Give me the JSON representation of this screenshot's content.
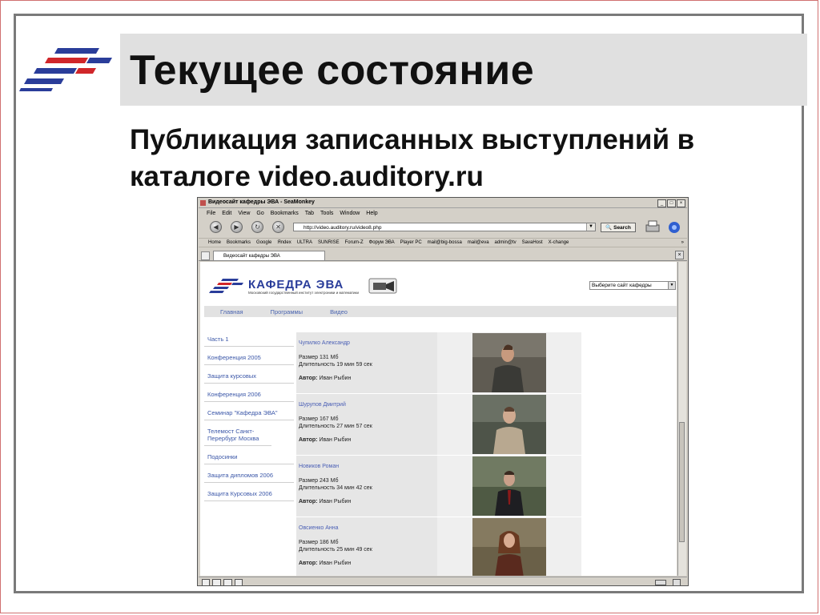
{
  "slide": {
    "title": "Текущее состояние",
    "subtitle": "Публикация записанных выступлений в каталоге video.auditory.ru"
  },
  "browser": {
    "window_title": "Видеосайт кафедры ЭВА - SeaMonkey",
    "menu": [
      "File",
      "Edit",
      "View",
      "Go",
      "Bookmarks",
      "Tab",
      "Tools",
      "Window",
      "Help"
    ],
    "url": "http://video.auditory.ru/video8.php",
    "search_label": "Search",
    "bookmarks": [
      "Home",
      "Bookmarks",
      "Google",
      "Яndex",
      "ULTRA",
      "SUNRISE",
      "Forum-Z",
      "Форум ЭВА",
      "Player PC",
      "mail@big-bossa",
      "mail@eva",
      "admin@tv",
      "SavaHost",
      "X-change"
    ],
    "bookmarks_more": "»",
    "tab_label": "Видеосайт кафедры ЭВА"
  },
  "site": {
    "name": "КАФЕДРА ЭВА",
    "institute": "Московский государственный институт электроники и математики",
    "select_value": "Выберите сайт кафедры",
    "nav": [
      "Главная",
      "Программы",
      "Видео"
    ],
    "sidebar": [
      "Часть 1",
      "Конференция 2005",
      "Защита курсовых",
      "Конференция 2006",
      "Семинар \"Кафедра ЭВА\"",
      "Телемост Санкт-Перербург Москва",
      "Подосинки",
      "Защита дипломов 2006",
      "Защита Курсовых 2006"
    ],
    "author_label": "Автор:",
    "videos": [
      {
        "name": "Чупилко Александр",
        "size": "Размер 131 Мб",
        "duration": "Длительность 19 мин 59 сек",
        "author": "Иван Рыбин"
      },
      {
        "name": "Шурупов Дмитрий",
        "size": "Размер 167 Мб",
        "duration": "Длительность 27 мин 57 сек",
        "author": "Иван Рыбин"
      },
      {
        "name": "Новиков Роман",
        "size": "Размер 243 Мб",
        "duration": "Длительность 34 мин 42 сек",
        "author": "Иван Рыбин"
      },
      {
        "name": "Овсиенко Анна",
        "size": "Размер 186 Мб",
        "duration": "Длительность 25 мин 49 сек",
        "author": "Иван Рыбин"
      }
    ]
  },
  "colors": {
    "brand_blue": "#2a3d9a",
    "brand_red": "#d0262a",
    "link": "#3b57a8"
  }
}
